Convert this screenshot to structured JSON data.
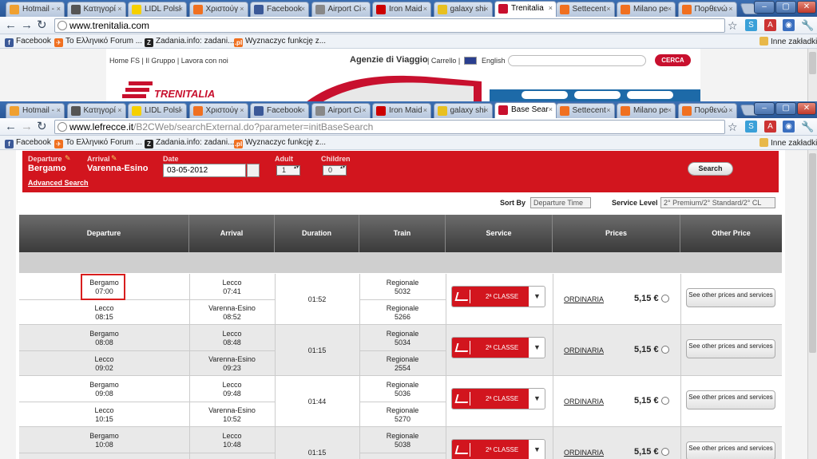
{
  "windowA": {
    "tabs": [
      {
        "label": "Hotmail -",
        "fav": "#f0a030"
      },
      {
        "label": "Κατηγορί",
        "fav": "#555555"
      },
      {
        "label": "LIDL Polsl",
        "fav": "#f6d000"
      },
      {
        "label": "Χριστούγ",
        "fav": "#f07020"
      },
      {
        "label": "Facebook",
        "fav": "#3b5998"
      },
      {
        "label": "Airport Ci",
        "fav": "#888888"
      },
      {
        "label": "Iron Maid",
        "fav": "#cc0000"
      },
      {
        "label": "galaxy shi",
        "fav": "#e8c020"
      },
      {
        "label": "Trenitalia",
        "fav": "#c8102e"
      },
      {
        "label": "Settecent",
        "fav": "#f07020"
      },
      {
        "label": "Milano pe",
        "fav": "#f07020"
      },
      {
        "label": "Πορθενώ",
        "fav": "#f07020"
      }
    ],
    "url": "www.trenitalia.com"
  },
  "windowB": {
    "tabs": [
      {
        "label": "Hotmail -",
        "fav": "#f0a030"
      },
      {
        "label": "Κατηγορί",
        "fav": "#555555"
      },
      {
        "label": "LIDL Polsl",
        "fav": "#f6d000"
      },
      {
        "label": "Χριστούγ",
        "fav": "#f07020"
      },
      {
        "label": "Facebook",
        "fav": "#3b5998"
      },
      {
        "label": "Airport Ci",
        "fav": "#888888"
      },
      {
        "label": "Iron Maid",
        "fav": "#cc0000"
      },
      {
        "label": "galaxy shi",
        "fav": "#e8c020"
      },
      {
        "label": "Base Sear",
        "fav": "#c8102e"
      },
      {
        "label": "Settecent",
        "fav": "#f07020"
      },
      {
        "label": "Milano pe",
        "fav": "#f07020"
      },
      {
        "label": "Πορθενώ",
        "fav": "#f07020"
      }
    ],
    "url_host": "www.lefrecce.it",
    "url_path": "/B2CWeb/searchExternal.do?parameter=initBaseSearch"
  },
  "bookmarks": [
    {
      "label": "Facebook",
      "color": "#3b5998",
      "glyph": "f"
    },
    {
      "label": "Το Ελληνικό Forum ...",
      "color": "#f07020",
      "glyph": "✈"
    },
    {
      "label": "Zadania.info: zadani...",
      "color": "#222222",
      "glyph": "Z"
    },
    {
      "label": "Wyznaczyc funkcję z...",
      "color": "#f07020",
      "glyph": ".pl"
    }
  ],
  "other_bookmarks": "Inne zakładki",
  "trenitalia": {
    "top_links": "Home FS  |  Il Gruppo  |  Lavora con noi",
    "agenzie": "Agenzie di Viaggio",
    "carrello": "|  Carrello  |",
    "english": "English",
    "cerca": "CERCA"
  },
  "form": {
    "departure_label": "Departure",
    "departure_value": "Bergamo",
    "arrival_label": "Arrival",
    "arrival_value": "Varenna-Esino",
    "date_label": "Date",
    "date_value": "03-05-2012",
    "adult_label": "Adult",
    "adult_value": "1",
    "children_label": "Children",
    "children_value": "0",
    "advanced": "Advanced Search",
    "search": "Search"
  },
  "sort": {
    "sort_label": "Sort By",
    "sort_value": "Departure Time",
    "service_label": "Service Level",
    "service_value": "2° Premium/2° Standard/2° CL"
  },
  "table": {
    "headers": [
      "Departure",
      "Arrival",
      "Duration",
      "Train",
      "Service",
      "Prices",
      "Other Price"
    ],
    "rows": [
      {
        "dep1": "Bergamo",
        "dep1t": "07:00",
        "arr1": "Lecco",
        "arr1t": "07:41",
        "dep2": "Lecco",
        "dep2t": "08:15",
        "arr2": "Varenna-Esino",
        "arr2t": "08:52",
        "duration": "01:52",
        "train1": "Regionale",
        "train1n": "5032",
        "train2": "Regionale",
        "train2n": "5266",
        "service": "2ª CLASSE",
        "fare": "ORDINARIA",
        "price": "5,15 €",
        "other": "See other prices and services"
      },
      {
        "dep1": "Bergamo",
        "dep1t": "08:08",
        "arr1": "Lecco",
        "arr1t": "08:48",
        "dep2": "Lecco",
        "dep2t": "09:02",
        "arr2": "Varenna-Esino",
        "arr2t": "09:23",
        "duration": "01:15",
        "train1": "Regionale",
        "train1n": "5034",
        "train2": "Regionale",
        "train2n": "2554",
        "service": "2ª CLASSE",
        "fare": "ORDINARIA",
        "price": "5,15 €",
        "other": "See other prices and services"
      },
      {
        "dep1": "Bergamo",
        "dep1t": "09:08",
        "arr1": "Lecco",
        "arr1t": "09:48",
        "dep2": "Lecco",
        "dep2t": "10:15",
        "arr2": "Varenna-Esino",
        "arr2t": "10:52",
        "duration": "01:44",
        "train1": "Regionale",
        "train1n": "5036",
        "train2": "Regionale",
        "train2n": "5270",
        "service": "2ª CLASSE",
        "fare": "ORDINARIA",
        "price": "5,15 €",
        "other": "See other prices and services"
      },
      {
        "dep1": "Bergamo",
        "dep1t": "10:08",
        "arr1": "Lecco",
        "arr1t": "10:48",
        "dep2": "",
        "dep2t": "",
        "arr2": "",
        "arr2t": "",
        "duration": "01:15",
        "train1": "Regionale",
        "train1n": "5038",
        "train2": "",
        "train2n": "",
        "service": "2ª CLASSE",
        "fare": "ORDINARIA",
        "price": "5,15 €",
        "other": "See other prices and services"
      }
    ]
  }
}
